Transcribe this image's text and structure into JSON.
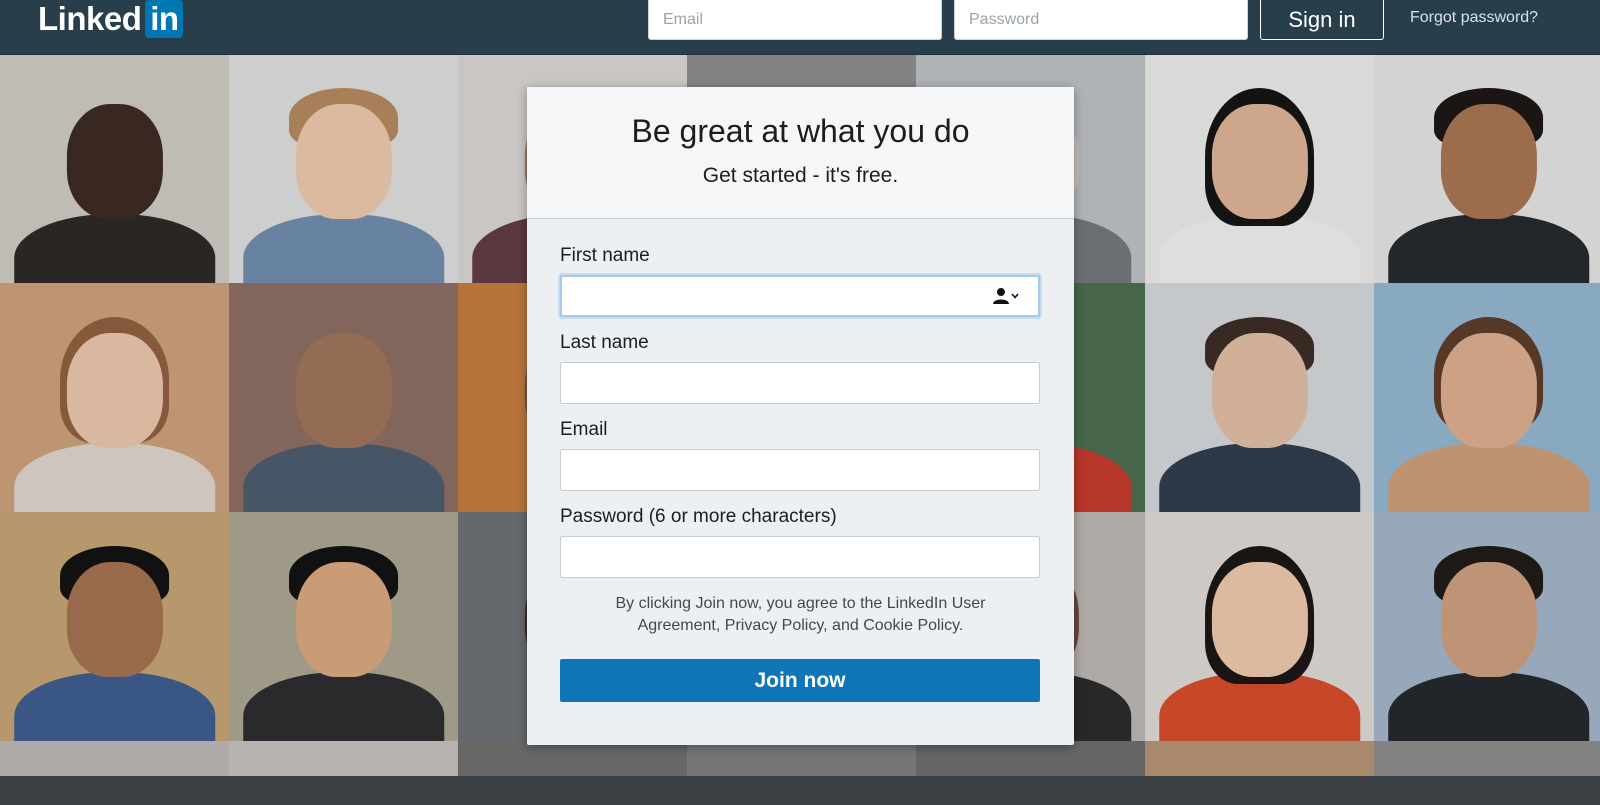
{
  "brand": {
    "logo_text": "Linked",
    "logo_box_text": "in",
    "accent_color": "#0077b5",
    "nav_color": "#283e4a"
  },
  "nav": {
    "email_placeholder": "Email",
    "password_placeholder": "Password",
    "signin_label": "Sign in",
    "forgot_label": "Forgot password?"
  },
  "signup": {
    "title": "Be great at what you do",
    "subtitle": "Get started - it's free.",
    "fields": [
      {
        "label": "First name",
        "value": "",
        "icon": "person-autofill-icon"
      },
      {
        "label": "Last name",
        "value": ""
      },
      {
        "label": "Email",
        "value": ""
      },
      {
        "label": "Password (6 or more characters)",
        "value": ""
      }
    ],
    "legal_text": "By clicking Join now, you agree to the LinkedIn User Agreement, Privacy Policy, and Cookie Policy.",
    "join_label": "Join now",
    "join_color": "#0e76b6"
  }
}
